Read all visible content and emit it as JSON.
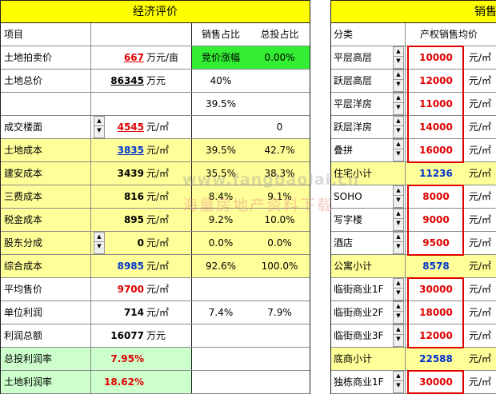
{
  "left": {
    "title": "经济评价",
    "header": {
      "item": "项目",
      "sales_ratio": "销售占比",
      "invest_ratio": "总投占比"
    },
    "rows": [
      {
        "label": "土地拍卖价",
        "value": "667",
        "unit": "万元/亩",
        "c3": "竞价涨幅",
        "c4": "0.00%"
      },
      {
        "label": "土地总价",
        "value": "86345",
        "unit": "万元",
        "c3": "40%",
        "c4": ""
      },
      {
        "label": "",
        "value": "",
        "unit": "",
        "c3": "39.5%",
        "c4": ""
      },
      {
        "label": "成交楼面",
        "value": "4545",
        "unit": "元/㎡",
        "c3": "",
        "c4": "0"
      },
      {
        "label": "土地成本",
        "value": "3835",
        "unit": "元/㎡",
        "c3": "39.5%",
        "c4": "42.7%"
      },
      {
        "label": "建安成本",
        "value": "3439",
        "unit": "元/㎡",
        "c3": "35.5%",
        "c4": "38.3%"
      },
      {
        "label": "三费成本",
        "value": "816",
        "unit": "元/㎡",
        "c3": "8.4%",
        "c4": "9.1%"
      },
      {
        "label": "税金成本",
        "value": "895",
        "unit": "元/㎡",
        "c3": "9.2%",
        "c4": "10.0%"
      },
      {
        "label": "股东分成",
        "value": "0",
        "unit": "元/㎡",
        "c3": "0.0%",
        "c4": "0.0%"
      },
      {
        "label": "综合成本",
        "value": "8985",
        "unit": "元/㎡",
        "c3": "92.6%",
        "c4": "100.0%"
      },
      {
        "label": "平均售价",
        "value": "9700",
        "unit": "元/㎡",
        "c3": "",
        "c4": ""
      },
      {
        "label": "单位利润",
        "value": "714",
        "unit": "元/㎡",
        "c3": "7.4%",
        "c4": "7.9%"
      },
      {
        "label": "利润总额",
        "value": "16077",
        "unit": "万元",
        "c3": "",
        "c4": ""
      },
      {
        "label": "总投利润率",
        "value": "7.95%",
        "unit": "",
        "c3": "",
        "c4": ""
      },
      {
        "label": "土地利润率",
        "value": "18.62%",
        "unit": "",
        "c3": "",
        "c4": ""
      }
    ]
  },
  "right": {
    "title": "销售",
    "header": {
      "category": "分类",
      "price": "产权销售均价"
    },
    "rows": [
      {
        "label": "平层高层",
        "value": "10000",
        "unit": "元/㎡"
      },
      {
        "label": "跃层高层",
        "value": "12000",
        "unit": "元/㎡"
      },
      {
        "label": "平层洋房",
        "value": "11000",
        "unit": "元/㎡"
      },
      {
        "label": "跃层洋房",
        "value": "14000",
        "unit": "元/㎡"
      },
      {
        "label": "叠拼",
        "value": "16000",
        "unit": "元/㎡"
      },
      {
        "label": "住宅小计",
        "value": "11236",
        "unit": "元/㎡"
      },
      {
        "label": "SOHO",
        "value": "8000",
        "unit": "元/㎡"
      },
      {
        "label": "写字楼",
        "value": "9000",
        "unit": "元/㎡"
      },
      {
        "label": "酒店",
        "value": "9500",
        "unit": "元/㎡"
      },
      {
        "label": "公寓小计",
        "value": "8578",
        "unit": "元/㎡"
      },
      {
        "label": "临街商业1F",
        "value": "30000",
        "unit": "元/㎡"
      },
      {
        "label": "临街商业2F",
        "value": "18000",
        "unit": "元/㎡"
      },
      {
        "label": "临街商业3F",
        "value": "12000",
        "unit": "元/㎡"
      },
      {
        "label": "底商小计",
        "value": "22588",
        "unit": "元/㎡"
      },
      {
        "label": "独栋商业1F",
        "value": "30000",
        "unit": "元/㎡"
      }
    ]
  },
  "watermark": {
    "line1": "www.fangbaolai.cn",
    "line2": "海量房地产资料下载"
  },
  "colors": {
    "header_yellow": "#ffff00",
    "row_yellow": "#ffff99",
    "row_green": "#ccffcc",
    "highlight_green": "#33ee33",
    "value_red": "#e00000",
    "value_blue": "#0033cc"
  }
}
